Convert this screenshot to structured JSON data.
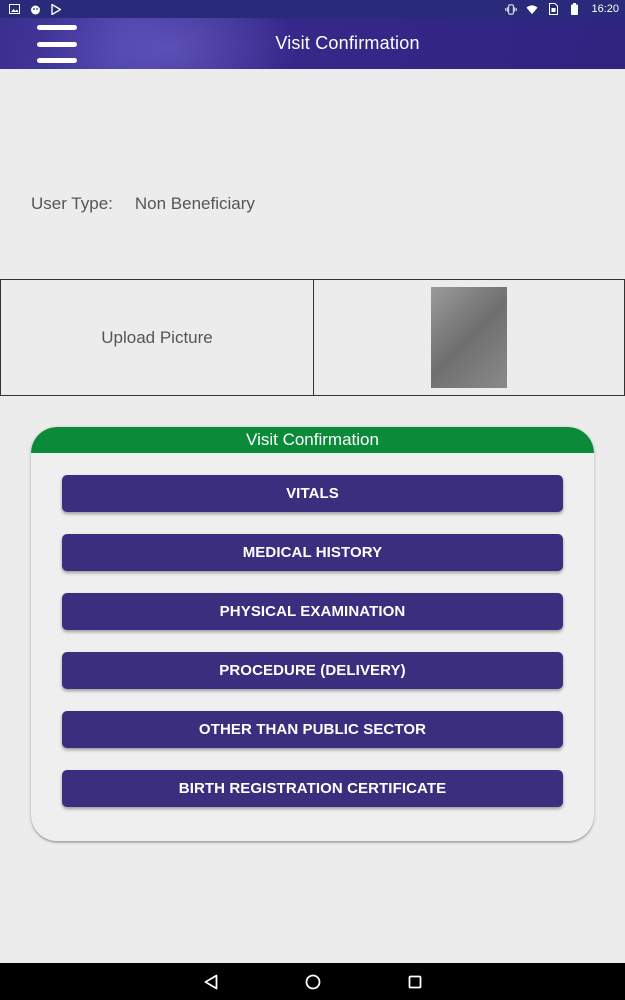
{
  "status_bar": {
    "time": "16:20",
    "left_icons": [
      "image-icon",
      "bug-icon",
      "play-store-icon"
    ],
    "right_icons": [
      "vibrate-icon",
      "wifi-icon",
      "sim-icon",
      "battery-icon"
    ]
  },
  "app_bar": {
    "title": "Visit Confirmation",
    "menu_icon": "hamburger-menu-icon"
  },
  "user_type": {
    "label": "User Type:",
    "value": "Non Beneficiary"
  },
  "upload": {
    "label": "Upload Picture"
  },
  "card": {
    "title": "Visit Confirmation",
    "buttons": [
      "VITALS",
      "MEDICAL HISTORY",
      "PHYSICAL EXAMINATION",
      "PROCEDURE (DELIVERY)",
      "OTHER THAN PUBLIC SECTOR",
      "BIRTH REGISTRATION CERTIFICATE"
    ]
  },
  "nav_bar": {
    "items": [
      "back-icon",
      "home-icon",
      "recents-icon"
    ]
  },
  "colors": {
    "app_bar": "#3a2f8f",
    "card_header": "#0b8a3a",
    "button": "#3b2e7e",
    "background": "#ececec"
  }
}
